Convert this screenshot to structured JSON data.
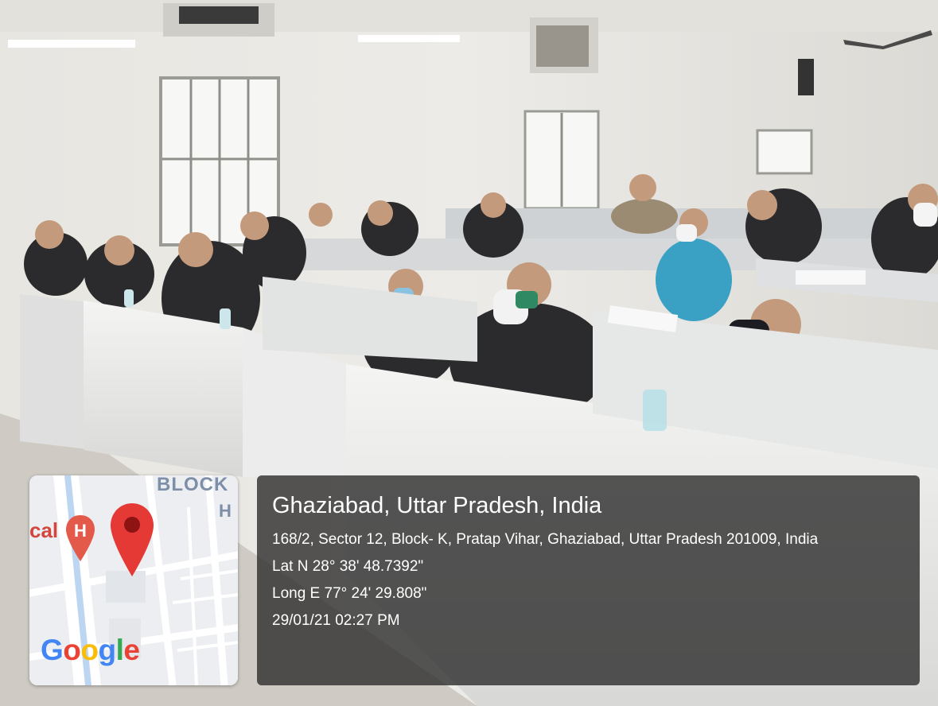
{
  "map": {
    "block_label": "BLOCK",
    "h_label": "H",
    "place_fragment": "cal",
    "hospital_marker": "hospital-H-marker-icon",
    "pin_icon": "location-pin-icon",
    "logo": "Google",
    "logo_colors": [
      "#4285f4",
      "#ea4335",
      "#fbbc05",
      "#4285f4",
      "#34a853",
      "#ea4335"
    ]
  },
  "location": {
    "title": "Ghaziabad, Uttar Pradesh, India",
    "address": "168/2, Sector 12, Block- K, Pratap Vihar, Ghaziabad, Uttar Pradesh 201009, India",
    "latitude": "Lat N 28° 38' 48.7392\"",
    "longitude": "Long E 77° 24' 29.808\"",
    "timestamp": "29/01/21 02:27 PM"
  }
}
